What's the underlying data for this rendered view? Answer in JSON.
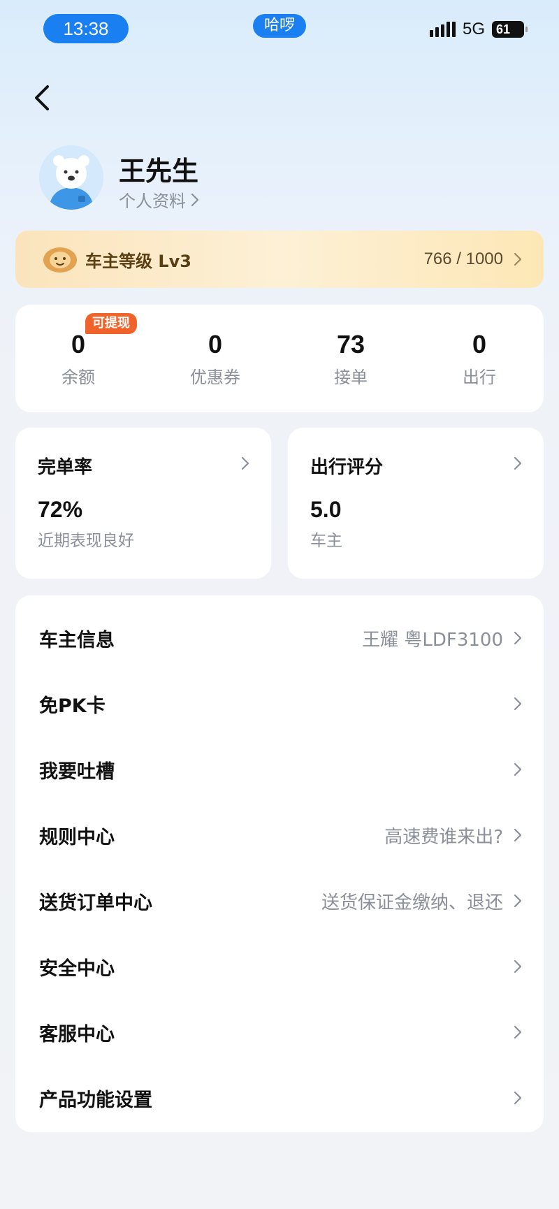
{
  "status_bar": {
    "time": "13:38",
    "center_label": "哈啰",
    "network": "5G",
    "battery": "61"
  },
  "profile": {
    "name": "王先生",
    "profile_link": "个人资料"
  },
  "level": {
    "label": "车主等级 Lv3",
    "progress": "766 / 1000"
  },
  "stats": [
    {
      "value": "0",
      "label": "余额",
      "badge": "可提现"
    },
    {
      "value": "0",
      "label": "优惠券"
    },
    {
      "value": "73",
      "label": "接单"
    },
    {
      "value": "0",
      "label": "出行"
    }
  ],
  "metrics": [
    {
      "title": "完单率",
      "value": "72%",
      "sub": "近期表现良好"
    },
    {
      "title": "出行评分",
      "value": "5.0",
      "sub": "车主"
    }
  ],
  "menu": [
    {
      "label": "车主信息",
      "value": "王耀 粤LDF3100"
    },
    {
      "label": "免PK卡",
      "value": ""
    },
    {
      "label": "我要吐槽",
      "value": ""
    },
    {
      "label": "规则中心",
      "value": "高速费谁来出?"
    },
    {
      "label": "送货订单中心",
      "value": "送货保证金缴纳、退还"
    },
    {
      "label": "安全中心",
      "value": ""
    },
    {
      "label": "客服中心",
      "value": ""
    },
    {
      "label": "产品功能设置",
      "value": ""
    }
  ],
  "colors": {
    "accent": "#1a7ff0",
    "badge": "#f0642b",
    "level_bg": "#fbe4bc"
  },
  "icons": {
    "back": "chevron-left-icon",
    "chevron": "chevron-right-icon",
    "avatar": "bear-avatar",
    "level": "lion-badge-icon"
  }
}
